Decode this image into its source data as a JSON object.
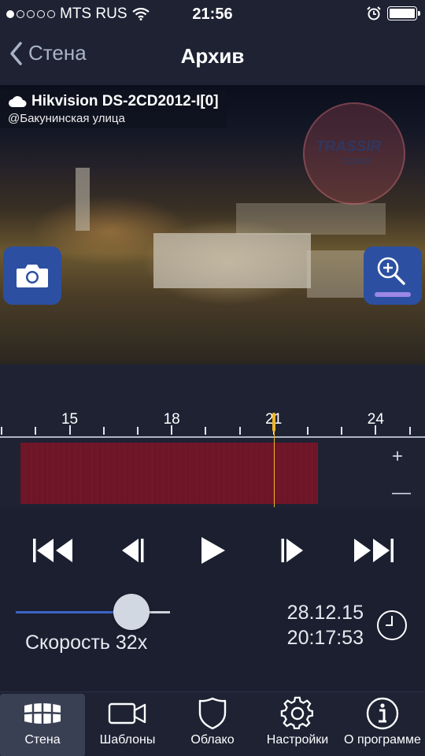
{
  "status_bar": {
    "carrier": "MTS RUS",
    "time": "21:56",
    "signal_dots": 5,
    "signal_filled": 1,
    "icons": [
      "wifi-icon",
      "alarm-icon",
      "battery-icon"
    ],
    "battery_level": 1.0
  },
  "nav": {
    "back_label": "Стена",
    "title": "Архив"
  },
  "camera": {
    "name": "Hikvision DS-2CD2012-I[0]",
    "location": "@Бакунинская улица",
    "watermark": "TRASSIR",
    "watermark_sub": "CLOUD"
  },
  "timeline": {
    "ticks": [
      {
        "hour": 15,
        "label": "15"
      },
      {
        "hour": 18,
        "label": "18"
      },
      {
        "hour": 21,
        "label": "21"
      },
      {
        "hour": 24,
        "label": "24"
      }
    ],
    "view_start_hour": 12.95,
    "view_end_hour": 25.45,
    "recording_start_hour": 12.9,
    "recording_end_hour": 22.3,
    "playhead_hour": 21.0,
    "zoom_in_label": "+",
    "zoom_out_label": "—",
    "recording_color": "#6e1528",
    "playhead_color": "#f0b429"
  },
  "playback": {
    "speed_label": "Скорость 32x",
    "speed_fraction": 0.75,
    "date": "28.12.15",
    "time": "20:17:53"
  },
  "tabs": [
    {
      "label": "Стена",
      "icon": "wall-grid-icon",
      "active": true
    },
    {
      "label": "Шаблоны",
      "icon": "video-camera-icon",
      "active": false
    },
    {
      "label": "Облако",
      "icon": "shield-icon",
      "active": false
    },
    {
      "label": "Настройки",
      "icon": "gear-icon",
      "active": false
    },
    {
      "label": "О программе",
      "icon": "info-icon",
      "active": false
    }
  ],
  "colors": {
    "background": "#1e2233",
    "accent": "#2c4fa1",
    "accent_light": "#3d63c6"
  }
}
